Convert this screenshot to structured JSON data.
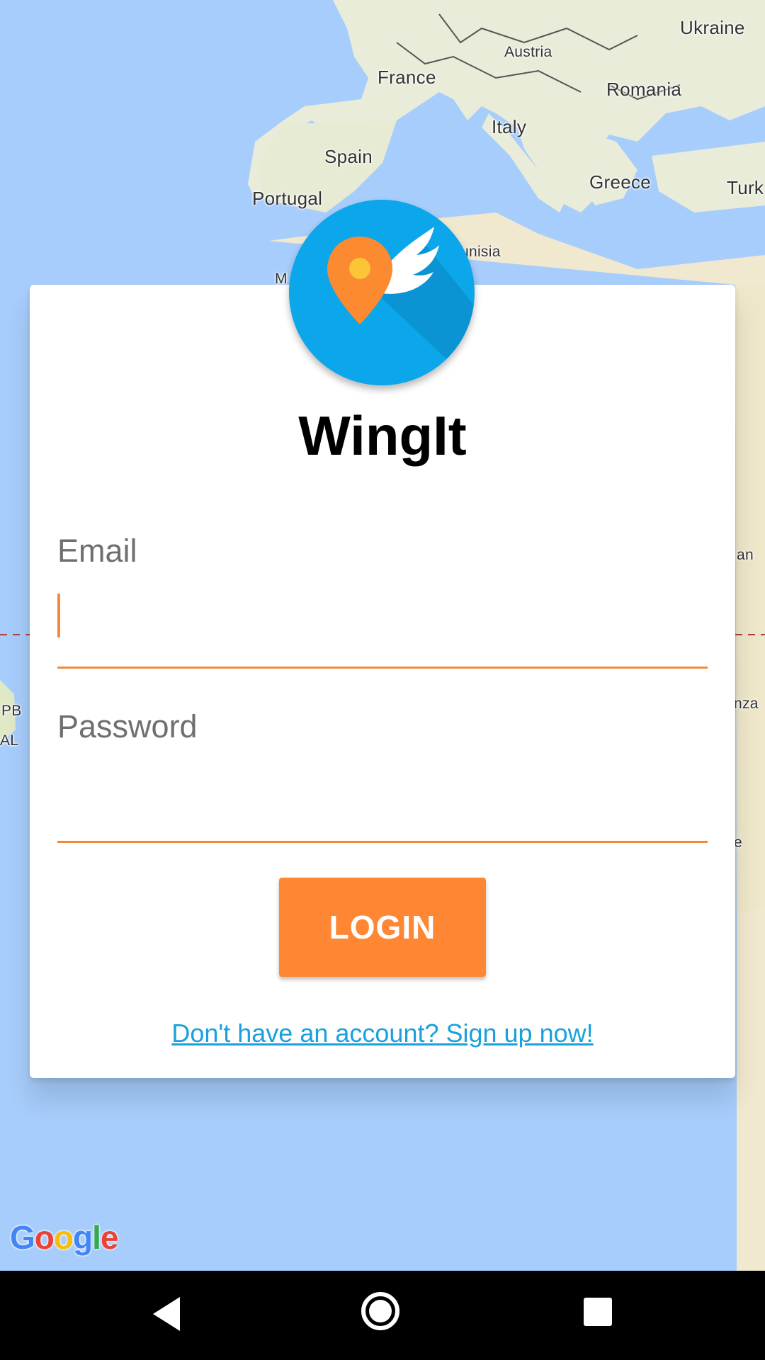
{
  "map": {
    "labels": {
      "ukraine": "Ukraine",
      "austria": "Austria",
      "france": "France",
      "romania": "Romania",
      "italy": "Italy",
      "spain": "Spain",
      "greece": "Greece",
      "turkey": "Turk",
      "portugal": "Portugal",
      "tunisia": "unisia",
      "morocco": "M",
      "right_an": "an",
      "right_nza": "nza",
      "right_e": "e",
      "left_pb": "PB",
      "left_al": "AL"
    },
    "attribution": [
      "G",
      "o",
      "o",
      "g",
      "l",
      "e"
    ]
  },
  "app": {
    "title": "WingIt"
  },
  "form": {
    "email_label": "Email",
    "email_value": "",
    "password_label": "Password",
    "password_value": "",
    "login_label": "LOGIN",
    "signup_link": "Don't have an account? Sign up now!"
  },
  "colors": {
    "accent": "#ff8633",
    "link": "#1aa0dc",
    "logo_bg": "#0ca6ea",
    "map_water": "#a7cdfc",
    "map_land": "#f0eede"
  },
  "navbar": {
    "icons": [
      "back-icon",
      "home-icon",
      "recent-apps-icon"
    ]
  }
}
